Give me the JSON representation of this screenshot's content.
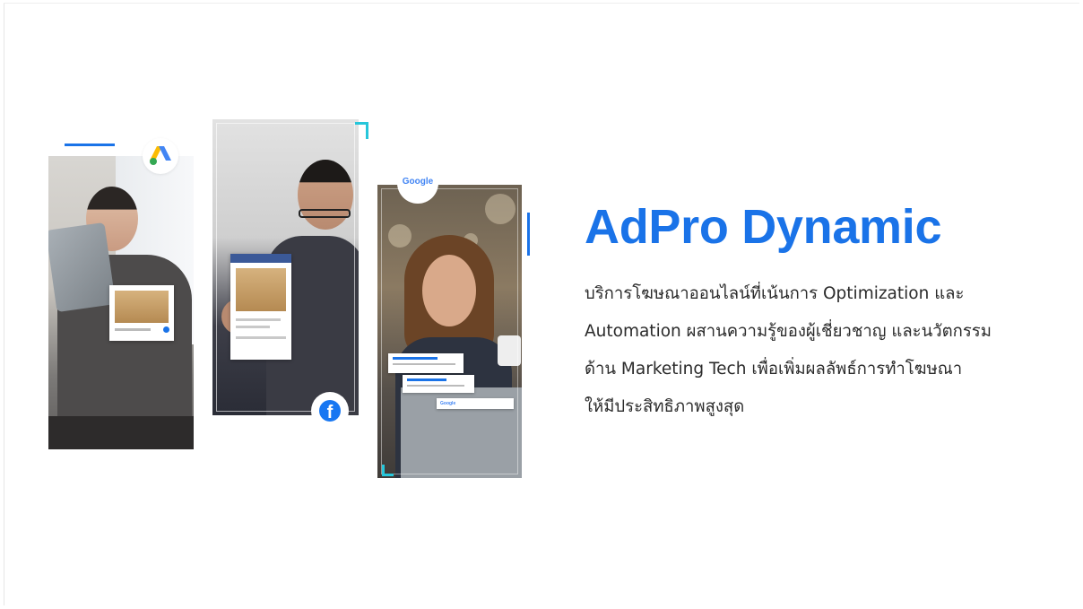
{
  "brand": {
    "title": "AdPro Dynamic",
    "accent_color": "#1a73e8"
  },
  "description": {
    "lines": [
      "บริการโฆษณาออนไลน์ที่เน้นการ Optimization และ",
      "Automation ผสานความรู้ของผู้เชี่ยวชาญ และนวัตกรรม",
      "ด้าน Marketing Tech เพื่อเพิ่มผลลัพธ์การทำโฆษณา",
      "ให้มีประสิทธิภาพสูงสุด"
    ]
  },
  "panels": [
    {
      "platform": "google-ads",
      "icon": "google-ads-icon"
    },
    {
      "platform": "facebook",
      "icon": "facebook-icon",
      "icon_glyph": "f"
    },
    {
      "platform": "google",
      "icon": "google-icon",
      "logo_text": "Google",
      "card_text": "Google"
    }
  ]
}
